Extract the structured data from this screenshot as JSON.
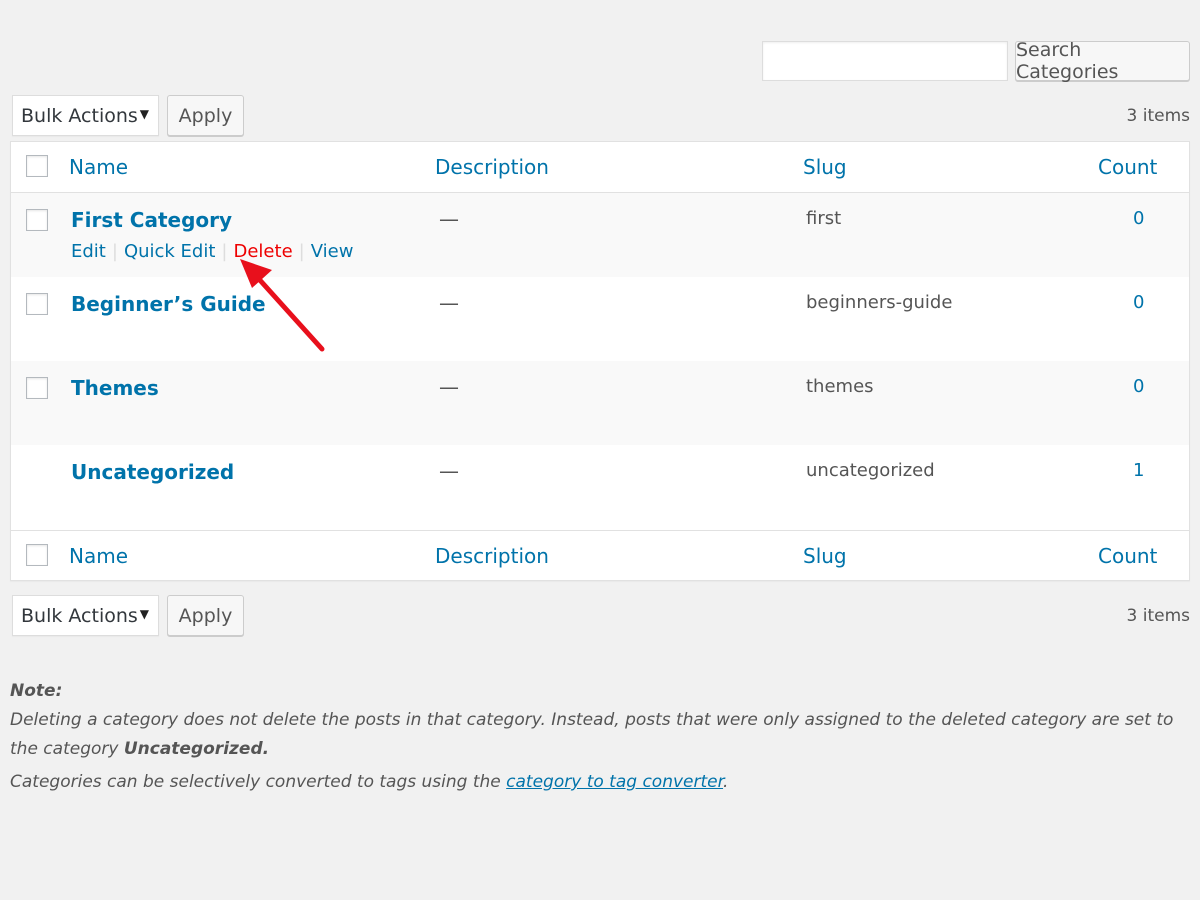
{
  "search": {
    "placeholder": "",
    "button_label": "Search Categories"
  },
  "top_nav": {
    "bulk_actions_label": "Bulk Actions",
    "apply_label": "Apply",
    "items_count": "3 items"
  },
  "bottom_nav": {
    "bulk_actions_label": "Bulk Actions",
    "apply_label": "Apply",
    "items_count": "3 items"
  },
  "table": {
    "columns": {
      "name": "Name",
      "description": "Description",
      "slug": "Slug",
      "count": "Count"
    },
    "rows": [
      {
        "name": "First Category",
        "description": "—",
        "slug": "first",
        "count": "0",
        "actions": {
          "edit": "Edit",
          "quick_edit": "Quick Edit",
          "delete": "Delete",
          "view": "View",
          "separator": "|"
        }
      },
      {
        "name": "Beginner’s Guide",
        "description": "—",
        "slug": "beginners-guide",
        "count": "0"
      },
      {
        "name": "Themes",
        "description": "—",
        "slug": "themes",
        "count": "0"
      },
      {
        "name": "Uncategorized",
        "description": "—",
        "slug": "uncategorized",
        "count": "1"
      }
    ]
  },
  "note": {
    "heading": "Note:",
    "line1": "Deleting a category does not delete the posts in that category. Instead, posts that were only assigned to the deleted category are set to the category",
    "line1_bold": "Uncategorized.",
    "line2_prefix": "Categories can be selectively converted to tags using the",
    "line2_link": "category to tag converter",
    "line2_suffix": "."
  },
  "colors": {
    "link": "#0073aa",
    "delete": "#e00000",
    "annotation_arrow": "#e8101c"
  }
}
